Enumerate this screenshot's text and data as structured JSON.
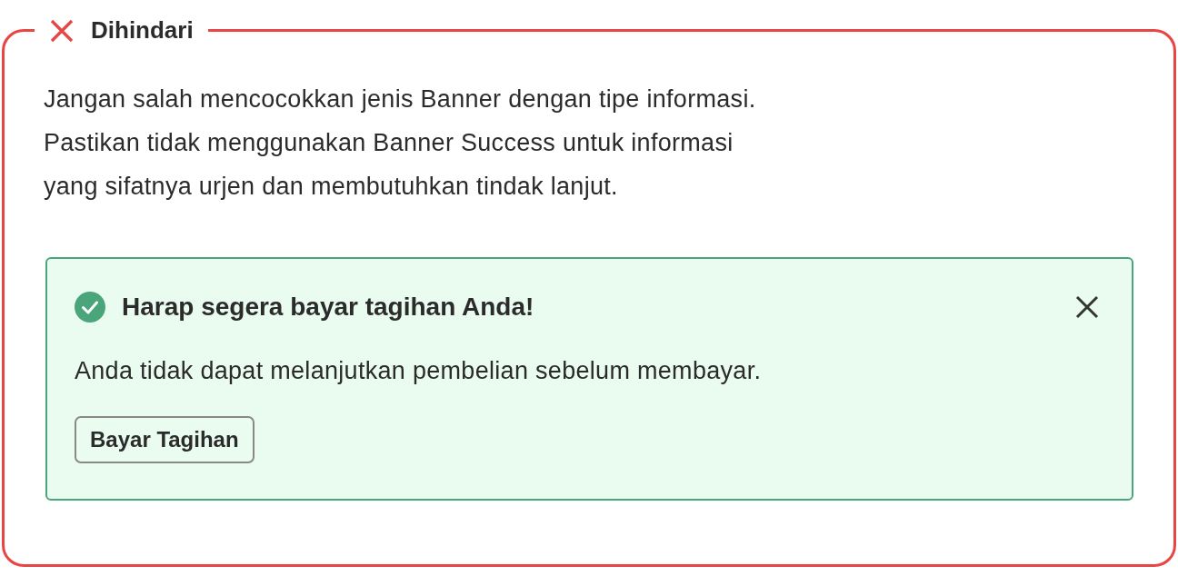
{
  "section": {
    "kind": "avoid",
    "title": "Dihindari",
    "description": "Jangan salah mencocokkan jenis Banner dengan tipe informasi.\nPastikan tidak menggunakan Banner Success untuk informasi\nyang sifatnya urjen dan membutuhkan tindak lanjut."
  },
  "banner": {
    "kind": "success",
    "title": "Harap segera bayar tagihan Anda!",
    "message": "Anda tidak dapat melanjutkan pembelian sebelum membayar.",
    "action": "Bayar Tagihan",
    "dismissible": true
  }
}
